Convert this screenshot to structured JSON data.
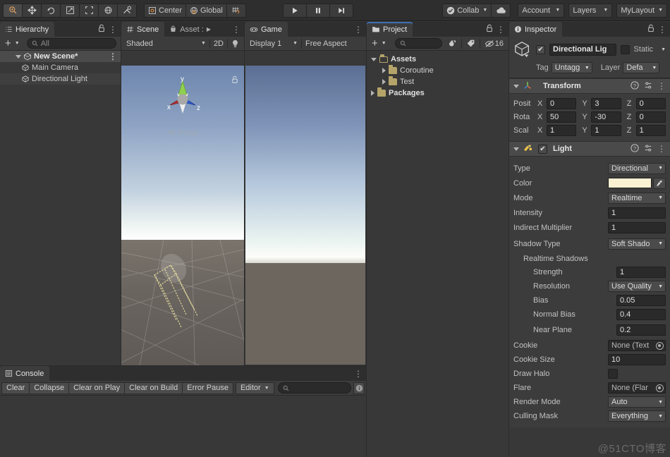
{
  "toolbar": {
    "tools": [
      {
        "name": "hand-tool",
        "icon": "magnify"
      },
      {
        "name": "move-tool",
        "icon": "move"
      },
      {
        "name": "rotate-tool",
        "icon": "rotate"
      },
      {
        "name": "scale-tool",
        "icon": "scale"
      },
      {
        "name": "rect-tool",
        "icon": "rect"
      },
      {
        "name": "transform-tool",
        "icon": "transform"
      },
      {
        "name": "custom-tool",
        "icon": "wrench"
      }
    ],
    "pivot_label": "Center",
    "handle_label": "Global",
    "grid_label": "",
    "play_label": "▶",
    "pause_label": "▐▐",
    "step_label": "▶|",
    "collab_label": "Collab",
    "cloud_label": "",
    "account_label": "Account",
    "layers_label": "Layers",
    "layout_label": "MyLayout"
  },
  "hierarchy": {
    "tab": "Hierarchy",
    "add_label": "+",
    "search_placeholder": "All",
    "items": [
      {
        "label": "New Scene*",
        "depth": 0,
        "expanded": true
      },
      {
        "label": "Main Camera",
        "depth": 1
      },
      {
        "label": "Directional Light",
        "depth": 1
      }
    ]
  },
  "scene": {
    "tabs": [
      {
        "label": "Scene",
        "selected": true
      },
      {
        "label": "Asset :",
        "selected": false
      }
    ],
    "shading_mode": "Shaded",
    "mode_2d": "2D",
    "gizmo_x": "x",
    "gizmo_y": "y",
    "gizmo_z": "z",
    "perspective_label": "Persp"
  },
  "game": {
    "tab": "Game",
    "display": "Display 1",
    "aspect": "Free Aspect"
  },
  "project": {
    "tab": "Project",
    "add_label": "+",
    "search_placeholder": "",
    "count_label": "16",
    "items": [
      {
        "label": "Assets",
        "depth": 0,
        "expanded": true,
        "bold": true
      },
      {
        "label": "Coroutine",
        "depth": 1,
        "expanded": false,
        "bold": false
      },
      {
        "label": "Test",
        "depth": 1,
        "expanded": false,
        "bold": false
      },
      {
        "label": "Packages",
        "depth": 0,
        "expanded": false,
        "bold": true
      }
    ]
  },
  "inspector": {
    "tab": "Inspector",
    "object_name": "Directional Lig",
    "enabled": true,
    "static_label": "Static",
    "tag_label": "Tag",
    "tag_value": "Untagg",
    "layer_label": "Layer",
    "layer_value": "Defa",
    "transform": {
      "title": "Transform",
      "position_label": "Posit",
      "rotation_label": "Rota",
      "scale_label": "Scal",
      "axes": [
        "X",
        "Y",
        "Z"
      ],
      "position": [
        "0",
        "3",
        "0"
      ],
      "rotation": [
        "50",
        "-30",
        "0"
      ],
      "scale": [
        "1",
        "1",
        "1"
      ]
    },
    "light": {
      "title": "Light",
      "enabled": true,
      "type_label": "Type",
      "type_value": "Directional",
      "color_label": "Color",
      "color_value": "#FAF0D2",
      "mode_label": "Mode",
      "mode_value": "Realtime",
      "intensity_label": "Intensity",
      "intensity_value": "1",
      "indirect_label": "Indirect Multiplier",
      "indirect_value": "1",
      "shadow_type_label": "Shadow Type",
      "shadow_type_value": "Soft Shado",
      "realtime_shadows_label": "Realtime Shadows",
      "strength_label": "Strength",
      "strength_value": "1",
      "resolution_label": "Resolution",
      "resolution_value": "Use Quality",
      "bias_label": "Bias",
      "bias_value": "0.05",
      "normal_bias_label": "Normal Bias",
      "normal_bias_value": "0.4",
      "near_plane_label": "Near Plane",
      "near_plane_value": "0.2",
      "cookie_label": "Cookie",
      "cookie_value": "None (Text",
      "cookie_size_label": "Cookie Size",
      "cookie_size_value": "10",
      "draw_halo_label": "Draw Halo",
      "draw_halo_checked": false,
      "flare_label": "Flare",
      "flare_value": "None (Flar",
      "render_mode_label": "Render Mode",
      "render_mode_value": "Auto",
      "culling_mask_label": "Culling Mask",
      "culling_mask_value": "Everything"
    }
  },
  "console": {
    "tab": "Console",
    "buttons": [
      "Clear",
      "Collapse",
      "Clear on Play",
      "Clear on Build",
      "Error Pause"
    ],
    "editor_label": "Editor",
    "search_placeholder": ""
  },
  "watermark": "@51CTO博客",
  "colors": {
    "panel_bg": "#383838",
    "toolbar_bg": "#2e2e2e",
    "accent": "#3d6fb0",
    "field_bg": "#2a2a2a"
  }
}
